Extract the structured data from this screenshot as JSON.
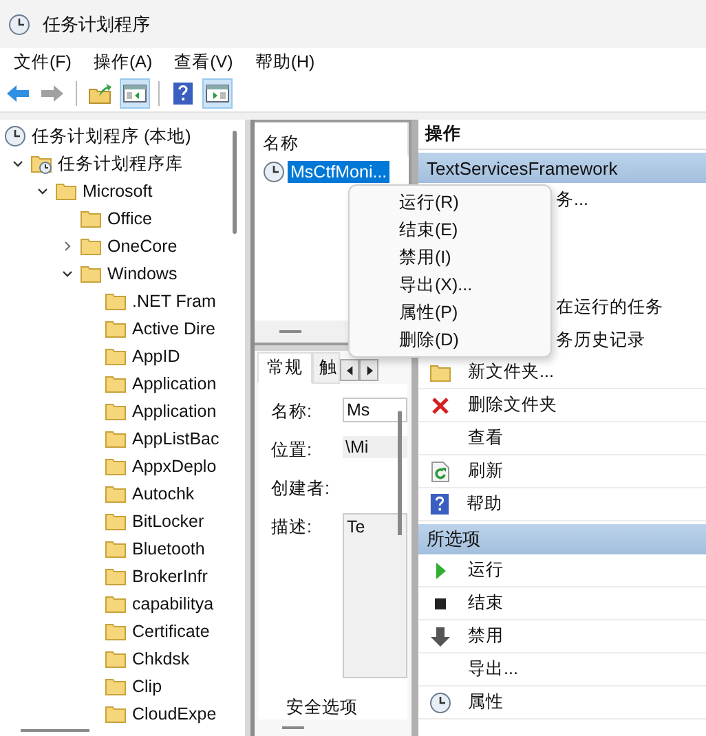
{
  "window": {
    "title": "任务计划程序"
  },
  "menu": [
    "文件(F)",
    "操作(A)",
    "查看(V)",
    "帮助(H)"
  ],
  "toolbar": [
    {
      "kind": "back",
      "disabled": false
    },
    {
      "kind": "forward",
      "disabled": true
    },
    {
      "kind": "separator"
    },
    {
      "kind": "up"
    },
    {
      "kind": "tree-toggle",
      "selected": true
    },
    {
      "kind": "separator"
    },
    {
      "kind": "help"
    },
    {
      "kind": "action-toggle",
      "selected": true
    }
  ],
  "tree": [
    {
      "label": "任务计划程序 (本地)",
      "kind": "root",
      "children": [
        {
          "label": "任务计划程序库",
          "kind": "library",
          "expanded": true,
          "children": [
            {
              "label": "Microsoft",
              "kind": "folder",
              "expanded": true,
              "children": [
                {
                  "label": "Office",
                  "kind": "folder"
                },
                {
                  "label": "OneCore",
                  "kind": "folder",
                  "expanded": false
                },
                {
                  "label": "Windows",
                  "kind": "folder",
                  "expanded": true,
                  "children": [
                    {
                      "label": ".NET Fram",
                      "kind": "folder"
                    },
                    {
                      "label": "Active Dire",
                      "kind": "folder"
                    },
                    {
                      "label": "AppID",
                      "kind": "folder"
                    },
                    {
                      "label": "Application",
                      "kind": "folder"
                    },
                    {
                      "label": "Application",
                      "kind": "folder"
                    },
                    {
                      "label": "AppListBac",
                      "kind": "folder"
                    },
                    {
                      "label": "AppxDeplo",
                      "kind": "folder"
                    },
                    {
                      "label": "Autochk",
                      "kind": "folder"
                    },
                    {
                      "label": "BitLocker",
                      "kind": "folder"
                    },
                    {
                      "label": "Bluetooth",
                      "kind": "folder"
                    },
                    {
                      "label": "BrokerInfr",
                      "kind": "folder"
                    },
                    {
                      "label": "capabilitya",
                      "kind": "folder"
                    },
                    {
                      "label": "Certificate",
                      "kind": "folder"
                    },
                    {
                      "label": "Chkdsk",
                      "kind": "folder"
                    },
                    {
                      "label": "Clip",
                      "kind": "folder"
                    },
                    {
                      "label": "CloudExpe",
                      "kind": "folder"
                    }
                  ]
                }
              ]
            }
          ]
        }
      ]
    }
  ],
  "task_list": {
    "column": "名称",
    "rows": [
      {
        "name": "MsCtfMoni...",
        "selected": true
      }
    ]
  },
  "details": {
    "tabs": [
      {
        "label": "常规",
        "selected": true
      },
      {
        "label": "触",
        "selected": false
      }
    ],
    "fields": [
      {
        "label": "名称:",
        "value": "Ms",
        "kind": "input"
      },
      {
        "label": "位置:",
        "value": "\\Mi",
        "kind": "readonly"
      },
      {
        "label": "创建者:",
        "kind": "readonly"
      },
      {
        "label": "描述:",
        "value": "Te",
        "kind": "textarea"
      }
    ],
    "footer": "安全选项"
  },
  "actions": {
    "title": "操作",
    "sections": [
      {
        "title": "TextServicesFramework",
        "items": [
          {
            "label": "务...",
            "kind": "partial"
          },
          {
            "label": "在运行的任务",
            "kind": "partial"
          },
          {
            "label": "务历史记录",
            "kind": "partial"
          },
          {
            "label": "新文件夹...",
            "kind": "folder"
          },
          {
            "label": "删除文件夹",
            "kind": "delete"
          },
          {
            "label": "查看",
            "kind": "plain"
          },
          {
            "label": "刷新",
            "kind": "refresh"
          },
          {
            "label": "帮助",
            "kind": "help"
          }
        ]
      },
      {
        "title": "所选项",
        "items": [
          {
            "label": "运行",
            "kind": "run"
          },
          {
            "label": "结束",
            "kind": "stop"
          },
          {
            "label": "禁用",
            "kind": "disable"
          },
          {
            "label": "导出...",
            "kind": "plain"
          },
          {
            "label": "属性",
            "kind": "properties"
          }
        ]
      }
    ]
  },
  "context_menu": [
    "运行(R)",
    "结束(E)",
    "禁用(I)",
    "导出(X)...",
    "属性(P)",
    "删除(D)"
  ]
}
